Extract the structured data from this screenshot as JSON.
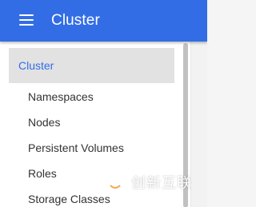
{
  "header": {
    "title": "Cluster",
    "menu_icon": "hamburger-menu-icon",
    "background_color": "#326de6"
  },
  "nav": {
    "section_label": "Cluster",
    "section_color": "#326de6",
    "items": [
      {
        "label": "Namespaces"
      },
      {
        "label": "Nodes"
      },
      {
        "label": "Persistent Volumes"
      },
      {
        "label": "Roles"
      },
      {
        "label": "Storage Classes"
      }
    ]
  },
  "watermark": {
    "text": "创新互联",
    "logo_icon": "watermark-logo-icon"
  }
}
